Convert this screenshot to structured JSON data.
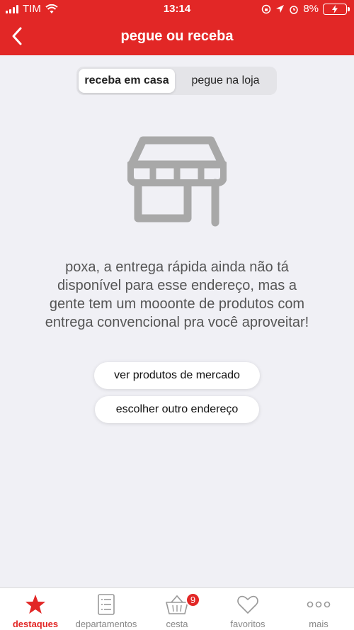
{
  "status_bar": {
    "carrier": "TIM",
    "time": "13:14",
    "battery": "8%"
  },
  "header": {
    "title": "pegue ou receba",
    "back_icon": "chevron-left-icon"
  },
  "segmented_control": {
    "options": [
      "receba em casa",
      "pegue na loja"
    ],
    "selected": "receba em casa"
  },
  "empty_state": {
    "icon": "store-icon",
    "message": "poxa, a entrega rápida ainda não tá disponível para esse endereço, mas a gente tem um mooonte de produtos com entrega convencional pra você aproveitar!"
  },
  "actions": {
    "primary": "ver produtos de mercado",
    "secondary": "escolher outro endereço"
  },
  "tab_bar": {
    "items": [
      {
        "label": "destaques",
        "icon": "star-icon"
      },
      {
        "label": "departamentos",
        "icon": "list-icon"
      },
      {
        "label": "cesta",
        "icon": "basket-icon"
      },
      {
        "label": "favoritos",
        "icon": "heart-icon"
      },
      {
        "label": "mais",
        "icon": "more-icon"
      }
    ],
    "active_index": 0,
    "cart_badge": "9"
  },
  "colors": {
    "brand_red": "#e22726",
    "background": "#f0f0f5"
  }
}
